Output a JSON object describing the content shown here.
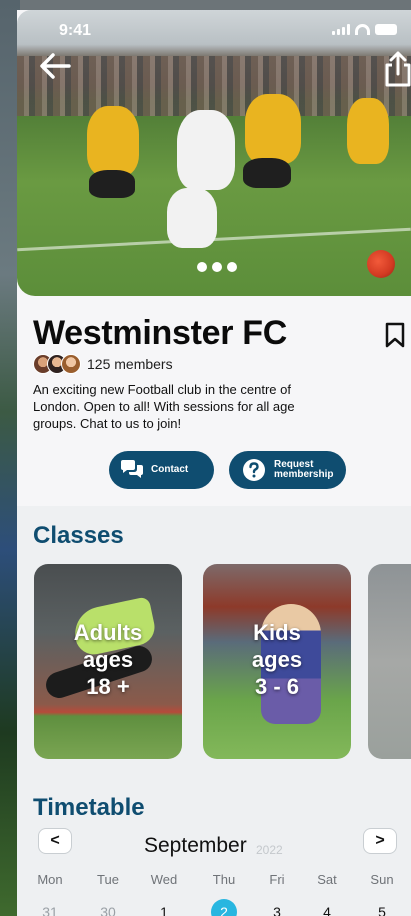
{
  "status": {
    "time": "9:41"
  },
  "club": {
    "name": "Westminster FC",
    "members": "125 members",
    "description": "An exciting new Football club in the centre of London. Open to all! With sessions for all age groups. Chat to us to join!"
  },
  "actions": {
    "contact_label": "Contact",
    "request_label_line1": "Request",
    "request_label_line2": "membership"
  },
  "classes": {
    "heading": "Classes",
    "cards": [
      {
        "line1": "Adults",
        "line2": "ages",
        "line3": "18 +"
      },
      {
        "line1": "Kids",
        "line2": "ages",
        "line3": "3 - 6"
      }
    ]
  },
  "timetable": {
    "heading": "Timetable",
    "month": "September",
    "year": "2022",
    "prev_label": "<",
    "next_label": ">",
    "weekdays": [
      "Mon",
      "Tue",
      "Wed",
      "Thu",
      "Fri",
      "Sat",
      "Sun"
    ],
    "days": [
      "31",
      "30",
      "1",
      "2",
      "3",
      "4",
      "5"
    ]
  },
  "colors": {
    "brand": "#0f4d70",
    "highlight": "#28b6e0"
  },
  "icons": {
    "back": "arrow-left-icon",
    "share": "share-icon",
    "bookmark": "bookmark-icon",
    "contact": "chat-bubbles-icon",
    "request": "question-circle-icon"
  }
}
